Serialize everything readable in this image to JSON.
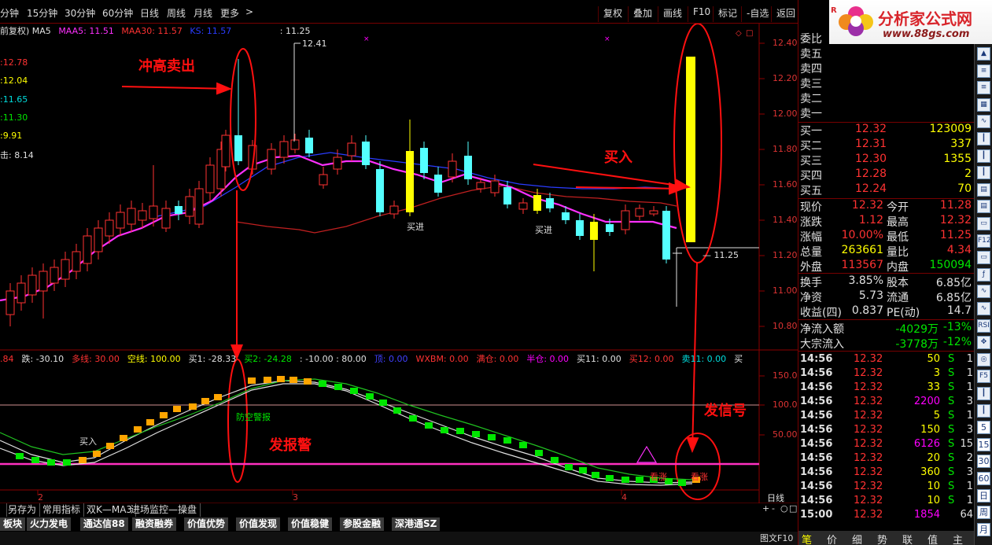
{
  "toolbar": {
    "periods": [
      "分钟",
      "15分钟",
      "30分钟",
      "60分钟",
      "日线",
      "周线",
      "月线",
      "更多"
    ],
    "more_arrow": ">",
    "buttons": [
      "复权",
      "叠加",
      "画线",
      "F10",
      "标记",
      "-自选",
      "返回"
    ]
  },
  "main_chart": {
    "legend": {
      "prefix": "前复权) MA5",
      "maa5": "MAA5: 11.51",
      "maa30": "MAA30: 11.57",
      "ks": "KS: 11.57",
      "cursor_price": ": 11.25"
    },
    "left_values": [
      ":12.78",
      ":12.04",
      ":11.65",
      ":11.30",
      ":9.91",
      "击: 8.14"
    ],
    "high_label": "12.41",
    "last_label": "— 11.25",
    "buy_label_1": "买进",
    "buy_label_2": "买进",
    "annot_chonggao": "冲高卖出",
    "annot_mairu": "买入",
    "axis": [
      "12.40",
      "12.20",
      "12.00",
      "11.80",
      "11.60",
      "11.40",
      "11.20",
      "11.00",
      "10.80"
    ]
  },
  "indicator": {
    "row": [
      {
        "text": ".84",
        "color": "#ff3232"
      },
      {
        "text": "跌: -30.10",
        "color": "#e0e0e0"
      },
      {
        "text": "多线: 30.00",
        "color": "#ff3232"
      },
      {
        "text": "空线: 100.00",
        "color": "#ffff00"
      },
      {
        "text": "买1: -28.33",
        "color": "#e0e0e0"
      },
      {
        "text": "买2: -24.28",
        "color": "#00e600"
      },
      {
        "text": ": -10.00 : 80.00",
        "color": "#e0e0e0"
      },
      {
        "text": "顶: 0.00",
        "color": "#4040ff"
      },
      {
        "text": "WXBM: 0.00",
        "color": "#ff3232"
      },
      {
        "text": "满仓: 0.00",
        "color": "#ff3232"
      },
      {
        "text": "半仓: 0.00",
        "color": "#ff00ff"
      },
      {
        "text": "买11: 0.00",
        "color": "#e0e0e0"
      },
      {
        "text": "买12: 0.00",
        "color": "#ff3232"
      },
      {
        "text": "卖11: 0.00",
        "color": "#00dcdc"
      },
      {
        "text": "买",
        "color": "#e0e0e0"
      }
    ],
    "axis": [
      "150.0",
      "100.0",
      "50.00"
    ],
    "label_mairu": "买入",
    "label_fangkong": "防空警报",
    "annot_baojing": "发报警",
    "annot_xinhao": "发信号",
    "label_kanzhang_1": "看涨",
    "label_kanzhang_2": "看涨",
    "date_marks": [
      "2",
      "3",
      "4"
    ],
    "period_label": "日线"
  },
  "bottom_tabs_1": [
    "",
    "另存为",
    "常用指标",
    "双K—MA3",
    "进场监控—操盘"
  ],
  "bottom_tabs_2": [
    "板块",
    "火力发电",
    "通达信88",
    "融资融券",
    "价值优势",
    "价值发现",
    "价值稳健",
    "参股金融",
    "深港通SZ"
  ],
  "bottom_controls": [
    "+",
    "-",
    "○",
    "□"
  ],
  "logo": {
    "title": "分析家公式网",
    "url": "www.88gs.com",
    "corner": "R"
  },
  "quote": {
    "weibi": "委比",
    "asks": [
      "卖五",
      "卖四",
      "卖三",
      "卖二",
      "卖一"
    ],
    "bids": [
      {
        "label": "买一",
        "price": "12.32",
        "vol": "123009"
      },
      {
        "label": "买二",
        "price": "12.31",
        "vol": "337"
      },
      {
        "label": "买三",
        "price": "12.30",
        "vol": "1355"
      },
      {
        "label": "买四",
        "price": "12.28",
        "vol": "2"
      },
      {
        "label": "买五",
        "price": "12.24",
        "vol": "70"
      }
    ],
    "stats": [
      {
        "l1": "现价",
        "v1": "12.32",
        "l2": "今开",
        "v2": "11.28",
        "c1": "#ff3232",
        "c2": "#ff3232"
      },
      {
        "l1": "涨跌",
        "v1": "1.12",
        "l2": "最高",
        "v2": "12.32",
        "c1": "#ff3232",
        "c2": "#ff3232"
      },
      {
        "l1": "涨幅",
        "v1": "10.00%",
        "l2": "最低",
        "v2": "11.25",
        "c1": "#ff3232",
        "c2": "#ff3232"
      },
      {
        "l1": "总量",
        "v1": "263661",
        "l2": "量比",
        "v2": "4.34",
        "c1": "#ffff00",
        "c2": "#ff3232"
      },
      {
        "l1": "外盘",
        "v1": "113567",
        "l2": "内盘",
        "v2": "150094",
        "c1": "#ff3232",
        "c2": "#00e600"
      }
    ],
    "stats2": [
      {
        "l1": "换手",
        "v1": "3.85%",
        "l2": "股本",
        "v2": "6.85亿"
      },
      {
        "l1": "净资",
        "v1": "5.73",
        "l2": "流通",
        "v2": "6.85亿"
      },
      {
        "l1": "收益(四)",
        "v1": "0.837",
        "l2": "PE(动)",
        "v2": "14.7"
      }
    ],
    "flows": [
      {
        "label": "净流入额",
        "v1": "-4029万",
        "v2": "-13%"
      },
      {
        "label": "大宗流入",
        "v1": "-3778万",
        "v2": "-12%"
      }
    ],
    "ticks": [
      {
        "t": "14:56",
        "p": "12.32",
        "v": "50",
        "s": "S",
        "n": "1",
        "vc": "#ffff00"
      },
      {
        "t": "14:56",
        "p": "12.32",
        "v": "3",
        "s": "S",
        "n": "1",
        "vc": "#ffff00"
      },
      {
        "t": "14:56",
        "p": "12.32",
        "v": "33",
        "s": "S",
        "n": "1",
        "vc": "#ffff00"
      },
      {
        "t": "14:56",
        "p": "12.32",
        "v": "2200",
        "s": "S",
        "n": "3",
        "vc": "#ff00ff"
      },
      {
        "t": "14:56",
        "p": "12.32",
        "v": "5",
        "s": "S",
        "n": "1",
        "vc": "#ffff00"
      },
      {
        "t": "14:56",
        "p": "12.32",
        "v": "150",
        "s": "S",
        "n": "3",
        "vc": "#ffff00"
      },
      {
        "t": "14:56",
        "p": "12.32",
        "v": "6126",
        "s": "S",
        "n": "15",
        "vc": "#ff00ff"
      },
      {
        "t": "14:56",
        "p": "12.32",
        "v": "20",
        "s": "S",
        "n": "2",
        "vc": "#ffff00"
      },
      {
        "t": "14:56",
        "p": "12.32",
        "v": "360",
        "s": "S",
        "n": "3",
        "vc": "#ffff00"
      },
      {
        "t": "14:56",
        "p": "12.32",
        "v": "10",
        "s": "S",
        "n": "1",
        "vc": "#ffff00"
      },
      {
        "t": "14:56",
        "p": "12.32",
        "v": "10",
        "s": "S",
        "n": "1",
        "vc": "#ffff00"
      },
      {
        "t": "15:00",
        "p": "12.32",
        "v": "1854",
        "s": "",
        "n": "64",
        "vc": "#ff00ff"
      }
    ],
    "tick_labels": [
      "笔",
      "价",
      "细",
      "势",
      "联",
      "值",
      "主"
    ],
    "f10_label": "图文F10"
  },
  "sidebar_icons": [
    "up-arrow-icon",
    "list-icon",
    "list-icon",
    "table-icon",
    "chart-icon",
    "kline-icon",
    "kline-icon",
    "kline-icon",
    "grid-icon",
    "grid-icon",
    "doc-icon",
    "F12",
    "doc-icon",
    "fx-icon",
    "chart-icon",
    "chart-icon",
    "RSI",
    "move-icon",
    "info-icon",
    "F5",
    "kline-icon",
    "kline-icon",
    "5",
    "15",
    "30",
    "60",
    "日",
    "周",
    "月"
  ]
}
